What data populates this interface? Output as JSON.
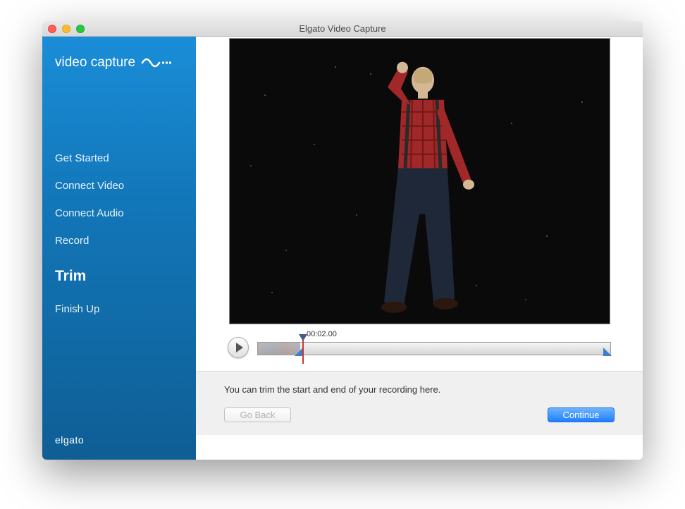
{
  "window": {
    "title": "Elgato Video Capture"
  },
  "sidebar": {
    "app_name_1": "video",
    "app_name_2": "capture",
    "nav": [
      {
        "label": "Get Started"
      },
      {
        "label": "Connect Video"
      },
      {
        "label": "Connect Audio"
      },
      {
        "label": "Record"
      },
      {
        "label": "Trim"
      },
      {
        "label": "Finish Up"
      }
    ],
    "active_index": 4,
    "footer_brand": "elgato"
  },
  "timeline": {
    "timecode": "00:02.00"
  },
  "info": {
    "hint": "You can trim the start and end of your recording here."
  },
  "buttons": {
    "back": "Go Back",
    "continue": "Continue"
  }
}
